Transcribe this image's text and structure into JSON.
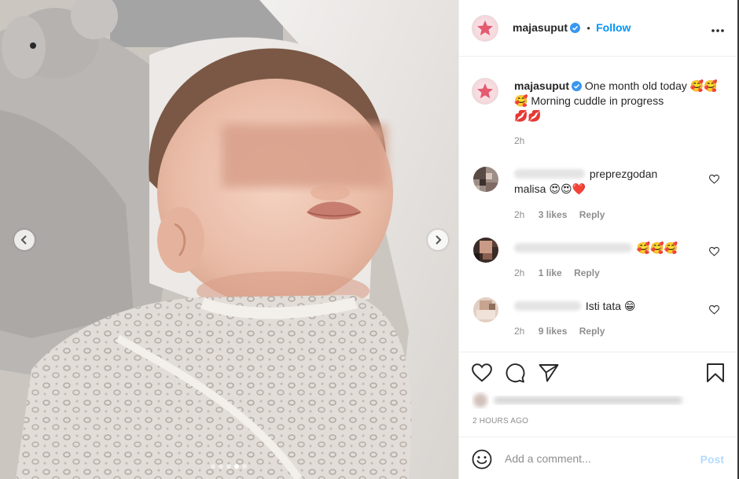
{
  "post": {
    "author": "majasuput",
    "follow_label": "Follow",
    "separator": "•",
    "more_icon": "more-horizontal-icon"
  },
  "caption": {
    "author": "majasuput",
    "text_part1": "One month old today",
    "text_part2": "Morning cuddle in progress",
    "emoji_faces": "🥰🥰🥰",
    "emoji_lips": "💋💋",
    "time": "2h"
  },
  "comments": [
    {
      "visible_text": "preprezgodan malisa",
      "emoji": "😍😍❤️",
      "time": "2h",
      "likes": "3 likes",
      "reply": "Reply"
    },
    {
      "visible_text": "",
      "emoji": "🥰🥰🥰",
      "time": "2h",
      "likes": "1 like",
      "reply": "Reply"
    },
    {
      "visible_text": "Isti tata",
      "emoji": "😁",
      "time": "2h",
      "likes": "9 likes",
      "reply": "Reply"
    }
  ],
  "actions": {
    "like_icon": "heart-icon",
    "comment_icon": "comment-icon",
    "share_icon": "paper-plane-icon",
    "save_icon": "bookmark-icon",
    "timestamp": "2 HOURS AGO"
  },
  "add_comment": {
    "placeholder": "Add a comment...",
    "post_label": "Post",
    "emoji_icon": "smiley-icon"
  },
  "colors": {
    "accent": "#0095f6",
    "text": "#262626",
    "muted": "#8e8e8e",
    "post_disabled": "#b3dbff",
    "verified": "#3897f0"
  },
  "carousel": {
    "slide_count": 5,
    "active_slide": 3
  }
}
